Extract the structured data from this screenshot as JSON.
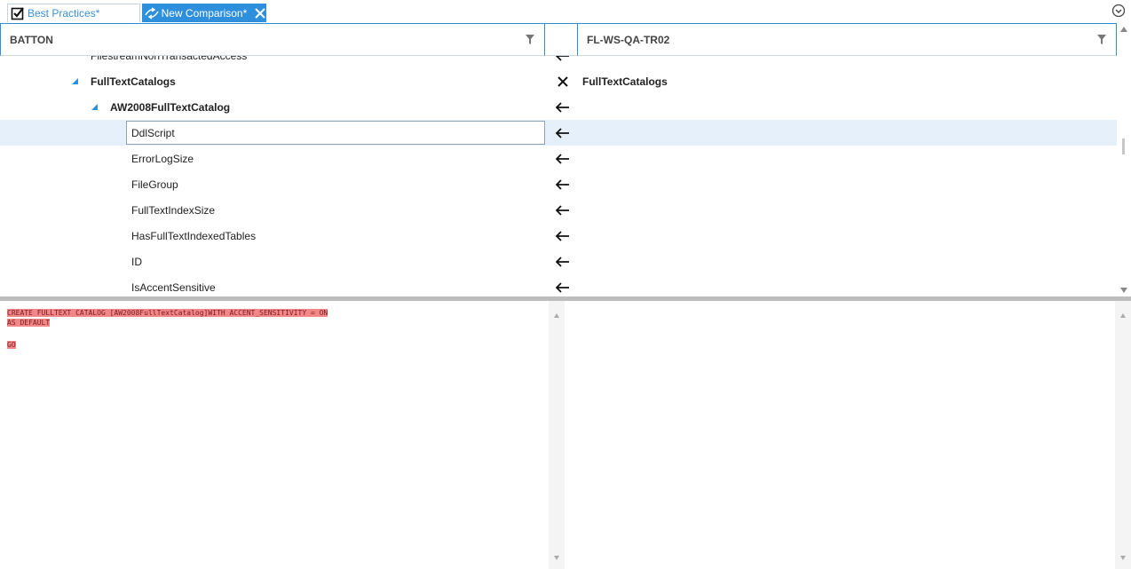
{
  "tabs": [
    {
      "label": "Best Practices*",
      "icon": "checkbox-icon"
    },
    {
      "label": "New Comparison*",
      "icon": "compare-icon",
      "close": "close-icon"
    }
  ],
  "headers": {
    "left_title": "BATTON",
    "right_title": "FL-WS-QA-TR02"
  },
  "tree": {
    "partial_row": "FilestreamNonTransactedAccess",
    "rows": [
      {
        "left": "FullTextCatalogs",
        "status": "x",
        "right": "FullTextCatalogs",
        "bold": true,
        "expander": true
      },
      {
        "left": "AW2008FullTextCatalog",
        "status": "arrow-left",
        "right": "",
        "bold": true,
        "expander": true
      },
      {
        "left": "DdlScript",
        "status": "arrow-left",
        "right": "",
        "selected": true
      },
      {
        "left": "ErrorLogSize",
        "status": "arrow-left",
        "right": ""
      },
      {
        "left": "FileGroup",
        "status": "arrow-left",
        "right": ""
      },
      {
        "left": "FullTextIndexSize",
        "status": "arrow-left",
        "right": ""
      },
      {
        "left": "HasFullTextIndexedTables",
        "status": "arrow-left",
        "right": ""
      },
      {
        "left": "ID",
        "status": "arrow-left",
        "right": ""
      },
      {
        "left": "IsAccentSensitive",
        "status": "arrow-left",
        "right": ""
      }
    ]
  },
  "script": {
    "line1": "CREATE FULLTEXT CATALOG [AW2008FullTextCatalog]WITH ACCENT_SENSITIVITY = ON",
    "line2": "AS DEFAULT",
    "line3": "GO"
  },
  "colors": {
    "accent": "#2e8fdc",
    "selection": "#e5f0fa",
    "diff_highlight": "#f2878a"
  }
}
